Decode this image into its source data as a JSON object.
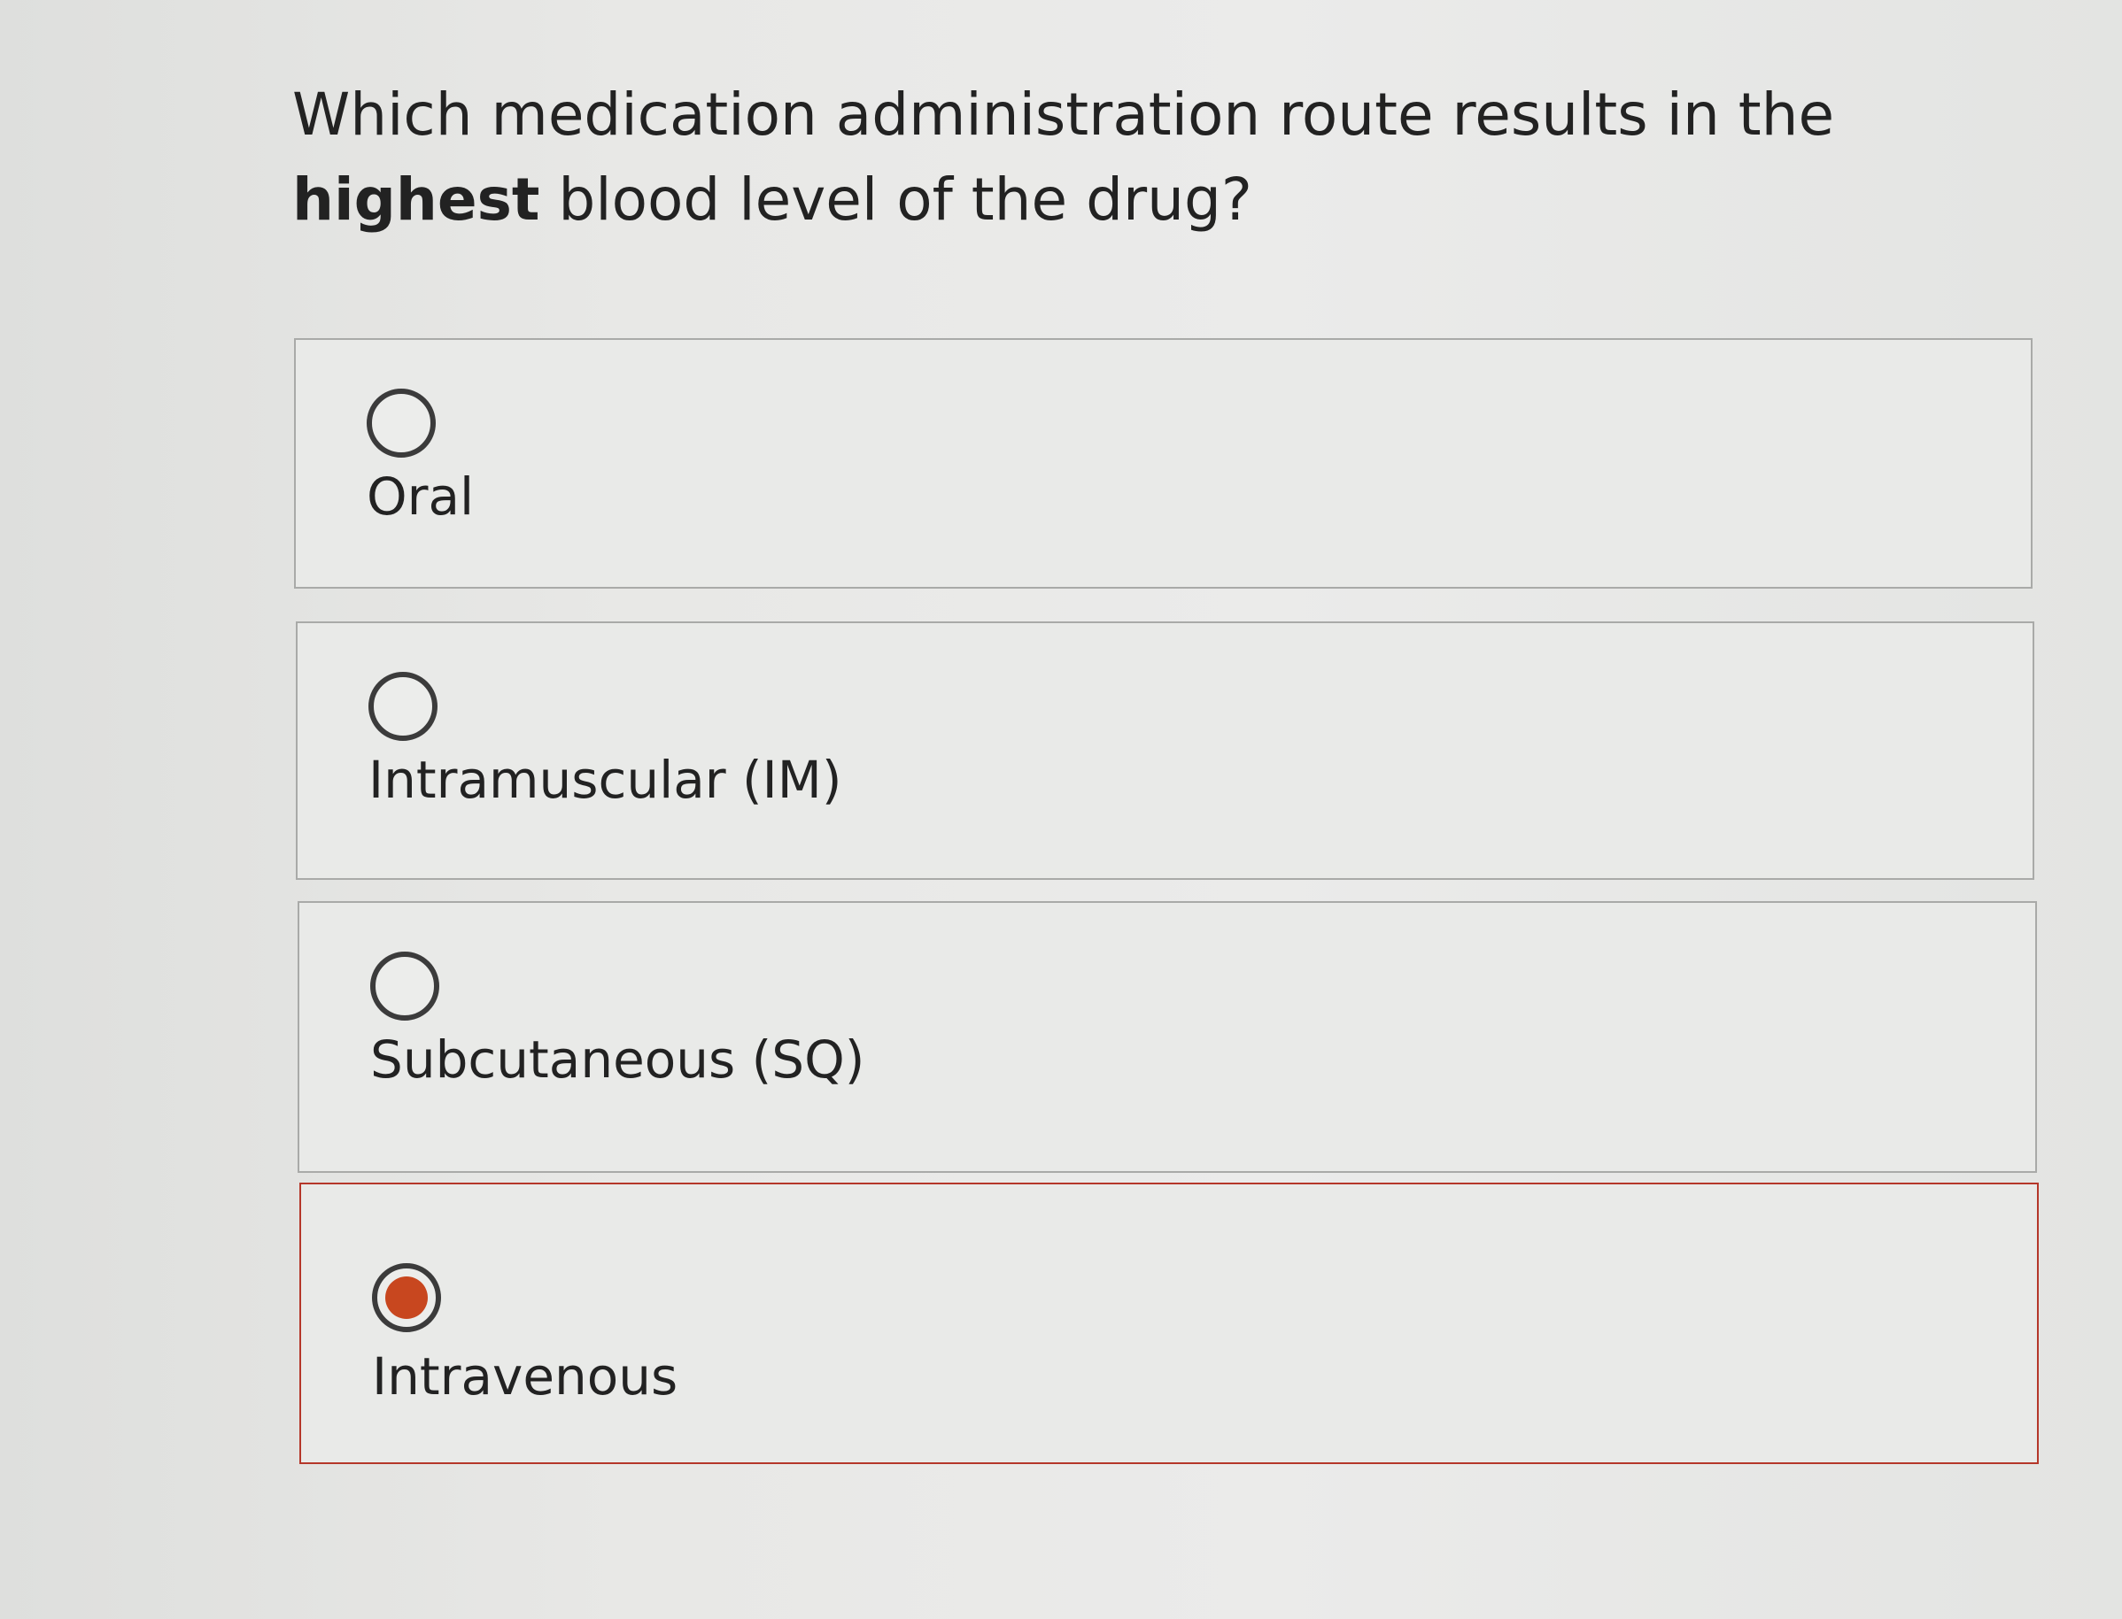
{
  "question": {
    "text_before": "Which medication administration route results in the ",
    "emphasis": "highest",
    "text_after": " blood level of the drug?"
  },
  "options": [
    {
      "label": "Oral",
      "selected": false
    },
    {
      "label": "Intramuscular (IM)",
      "selected": false
    },
    {
      "label": "Subcutaneous (SQ)",
      "selected": false
    },
    {
      "label": "Intravenous",
      "selected": true
    }
  ],
  "colors": {
    "selected_accent": "#c8471f",
    "selected_border": "#b5372a",
    "radio_border": "#3b3b3b"
  }
}
